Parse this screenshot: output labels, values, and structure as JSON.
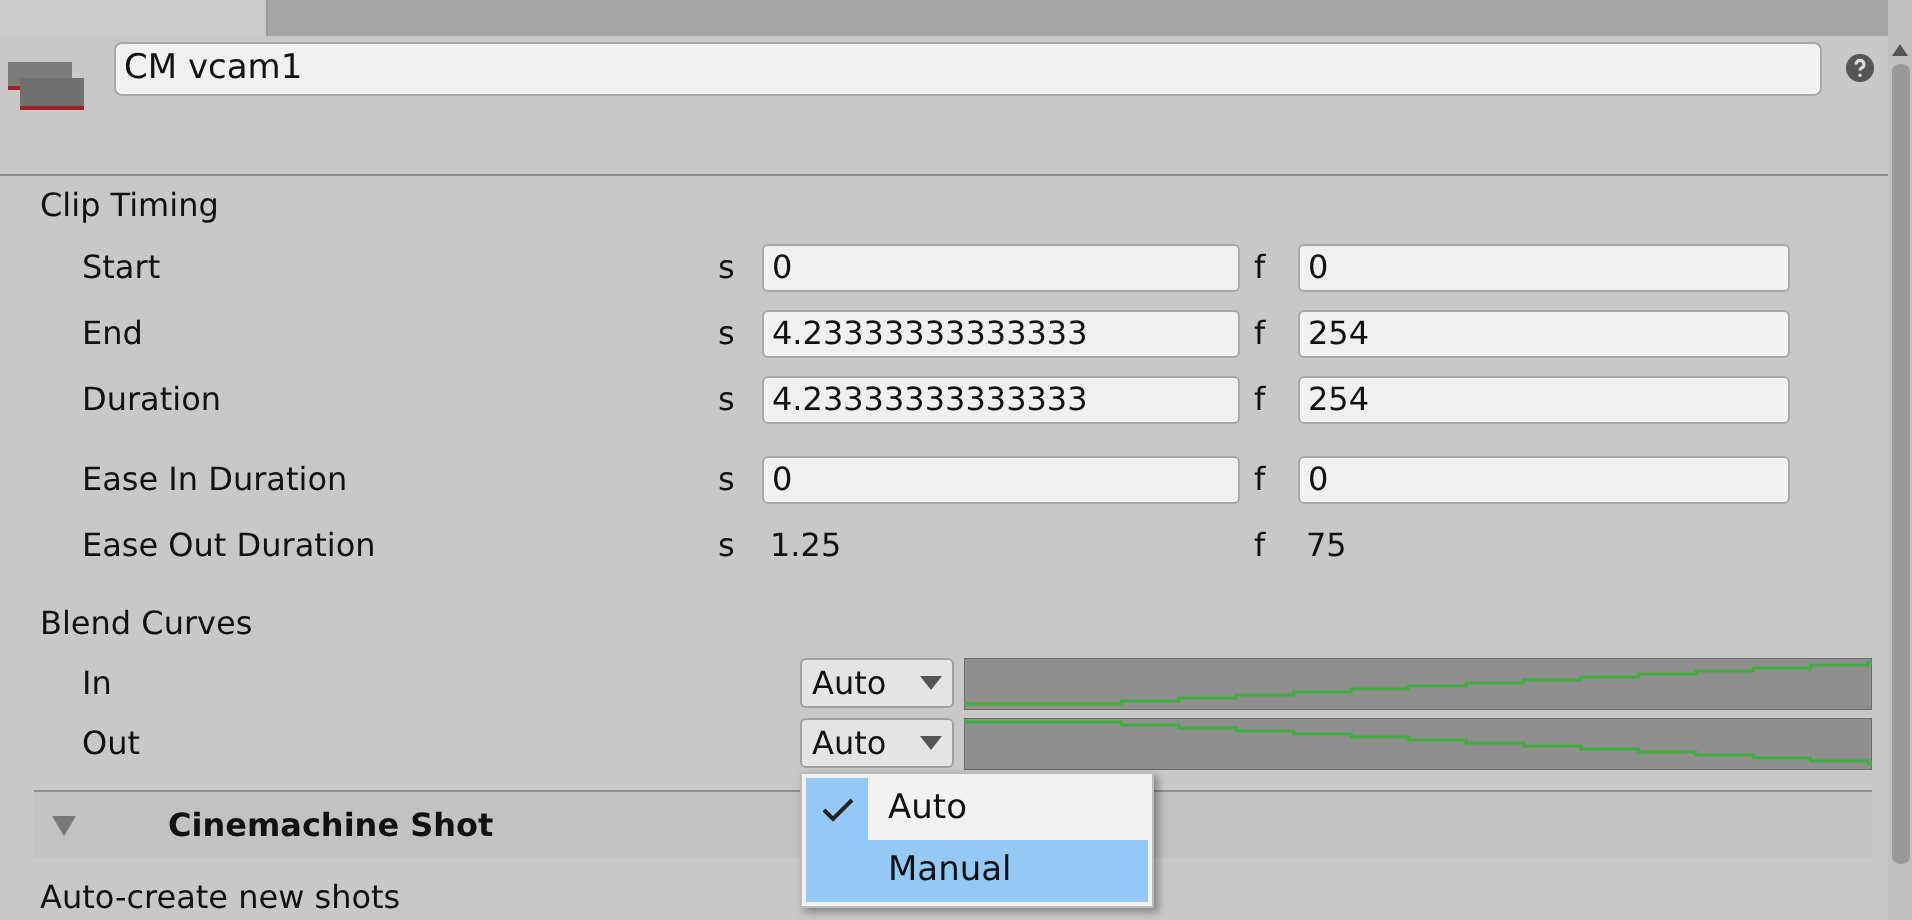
{
  "object_name": "CM vcam1",
  "clip_timing": {
    "title": "Clip Timing",
    "rows": [
      {
        "label": "Start",
        "kind": "field",
        "s_unit": "s",
        "seconds": "0",
        "f_unit": "f",
        "frames": "0"
      },
      {
        "label": "End",
        "kind": "field",
        "s_unit": "s",
        "seconds": "4.23333333333333",
        "f_unit": "f",
        "frames": "254"
      },
      {
        "label": "Duration",
        "kind": "field",
        "s_unit": "s",
        "seconds": "4.23333333333333",
        "f_unit": "f",
        "frames": "254"
      },
      {
        "label": "Ease In Duration",
        "kind": "field",
        "s_unit": "s",
        "seconds": "0",
        "f_unit": "f",
        "frames": "0"
      },
      {
        "label": "Ease Out Duration",
        "kind": "readonly",
        "s_unit": "s",
        "seconds": "1.25",
        "f_unit": "f",
        "frames": "75"
      }
    ]
  },
  "blend_curves": {
    "title": "Blend Curves",
    "rows": [
      {
        "label": "In",
        "value": "Auto",
        "kind": "rising"
      },
      {
        "label": "Out",
        "value": "Auto",
        "kind": "falling"
      }
    ]
  },
  "dropdown_menu": {
    "items": [
      {
        "label": "Auto",
        "checked": true,
        "selected": false
      },
      {
        "label": "Manual",
        "checked": false,
        "selected": true
      }
    ]
  },
  "section": {
    "title": "Cinemachine Shot",
    "expanded": true
  },
  "next_field": {
    "label": "Auto-create new shots"
  }
}
